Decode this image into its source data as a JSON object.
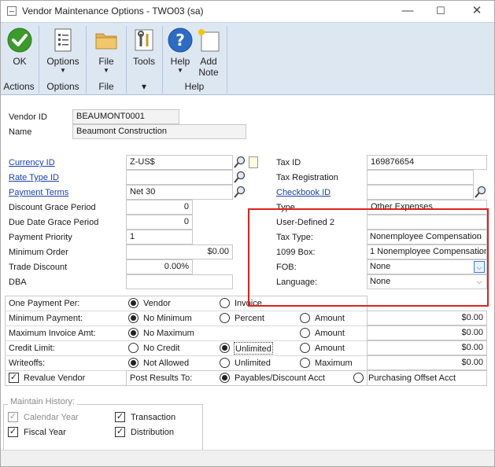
{
  "window": {
    "title": "Vendor Maintenance Options  -  TWO03 (sa)"
  },
  "title_buttons": {
    "minimize": "—",
    "maximize": "☐",
    "close": "✕"
  },
  "ribbon": {
    "ok": "OK",
    "options": "Options",
    "file": "File",
    "tools": "Tools",
    "help": "Help",
    "add": "Add",
    "note": "Note",
    "arrow": "▼",
    "groups": {
      "actions": "Actions",
      "options": "Options",
      "file": "File",
      "tools": "▾",
      "help": "Help"
    }
  },
  "vendor": {
    "id_label": "Vendor ID",
    "id_value": "BEAUMONT0001",
    "name_label": "Name",
    "name_value": "Beaumont Construction"
  },
  "left": {
    "currency_label": "Currency ID",
    "currency_value": "Z-US$",
    "rate_type_label": "Rate Type ID",
    "rate_type_value": "",
    "payment_terms_label": "Payment Terms",
    "payment_terms_value": "Net 30",
    "discount_grace_label": "Discount Grace Period",
    "discount_grace_value": "0",
    "due_grace_label": "Due Date Grace Period",
    "due_grace_value": "0",
    "priority_label": "Payment Priority",
    "priority_value": "1",
    "min_order_label": "Minimum Order",
    "min_order_value": "$0.00",
    "trade_discount_label": "Trade Discount",
    "trade_discount_value": "0.00%",
    "dba_label": "DBA",
    "dba_value": ""
  },
  "right": {
    "tax_id_label": "Tax ID",
    "tax_id_value": "169876654",
    "tax_reg_label": "Tax Registration",
    "tax_reg_value": "",
    "checkbook_label": "Checkbook ID",
    "checkbook_value": "",
    "type_label": "Type",
    "type_value": "Other Expenses",
    "ud2_label": "User-Defined 2",
    "ud2_value": "",
    "tax_type_label": "Tax Type:",
    "tax_type_value": "Nonemployee Compensation",
    "box1099_label": "1099 Box:",
    "box1099_value": "1 Nonemployee Compensation",
    "fob_label": "FOB:",
    "fob_value": "None",
    "language_label": "Language:",
    "language_value": "None"
  },
  "options": {
    "one_payment": {
      "label": "One Payment Per:",
      "o1": "Vendor",
      "o2": "Invoice"
    },
    "min_payment": {
      "label": "Minimum Payment:",
      "o1": "No Minimum",
      "o2": "Percent",
      "o3": "Amount",
      "value": "$0.00"
    },
    "max_invoice": {
      "label": "Maximum Invoice Amt:",
      "o1": "No Maximum",
      "o3": "Amount",
      "value": "$0.00"
    },
    "credit_limit": {
      "label": "Credit Limit:",
      "o1": "No Credit",
      "o2": "Unlimited",
      "o3": "Amount",
      "value": "$0.00"
    },
    "writeoffs": {
      "label": "Writeoffs:",
      "o1": "Not Allowed",
      "o2": "Unlimited",
      "o3": "Maximum",
      "value": "$0.00"
    },
    "revalue_label": "Revalue Vendor",
    "post_results": {
      "label": "Post Results To:",
      "o1": "Payables/Discount Acct",
      "o2": "Purchasing Offset Acct"
    }
  },
  "history": {
    "legend": "Maintain History:",
    "calendar_year": "Calendar Year",
    "fiscal_year": "Fiscal Year",
    "transaction": "Transaction",
    "distribution": "Distribution"
  },
  "checkmark": "✓",
  "chevron": "⌵",
  "colors": {
    "link": "#1a42b3",
    "ribbon": "#dde7f2",
    "highlight": "#e02020"
  }
}
